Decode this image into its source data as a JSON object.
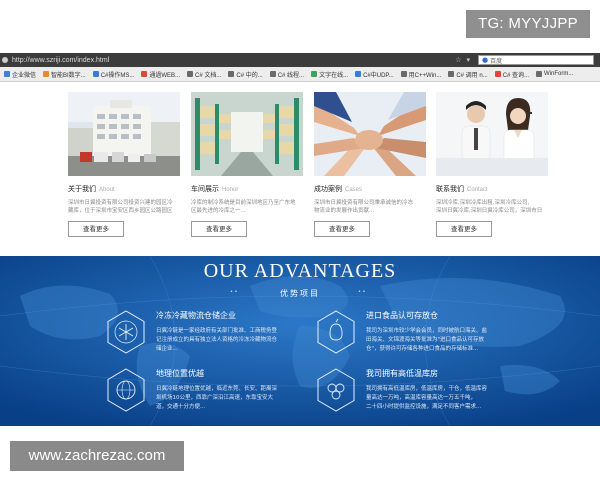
{
  "overlays": {
    "tg_label": "TG: MYYJJPP",
    "watermark": "www.zachrezac.com"
  },
  "browser": {
    "url": "http://www.szriji.com/index.html",
    "search_placeholder": "百度",
    "bookmarks": [
      {
        "label": "企业微信",
        "color": "#3b83d1"
      },
      {
        "label": "智能BI数字...",
        "color": "#e68a2e"
      },
      {
        "label": "C#操作MS...",
        "color": "#3a7bd5"
      },
      {
        "label": "通過WEB...",
        "color": "#d94a38"
      },
      {
        "label": "C# 文档...",
        "color": "#6a6a6a"
      },
      {
        "label": "C# 中的...",
        "color": "#6a6a6a"
      },
      {
        "label": "C# 线程...",
        "color": "#6a6a6a"
      },
      {
        "label": "文字在线...",
        "color": "#3ea35c"
      },
      {
        "label": "C#中UDP...",
        "color": "#3a7bd5"
      },
      {
        "label": "用C++Win...",
        "color": "#6a6a6a"
      },
      {
        "label": "C# 调用 n...",
        "color": "#6a6a6a"
      },
      {
        "label": "C# 查询...",
        "color": "#d94a38"
      },
      {
        "label": "WinForm...",
        "color": "#6a6a6a"
      }
    ]
  },
  "cards": [
    {
      "title": "关于我们",
      "title_en": "About",
      "desc1": "深圳市日冀投资有限公司投资兴建的园区冷",
      "desc2": "藏库，位于深圳市宝安区西乡园区公路园区",
      "button": "查看更多"
    },
    {
      "title": "车间展示",
      "title_en": "Honor",
      "desc1": "冷库的制冷系统是目前深圳地区乃至广东地",
      "desc2": "区最先进的冷库之一...",
      "button": "查看更多"
    },
    {
      "title": "成功案例",
      "title_en": "Cases",
      "desc1": "深圳市日冀投资有限公司秉承诚信的冷冻",
      "desc2": "物流业的发展作出贡献...",
      "button": "查看更多"
    },
    {
      "title": "联系我们",
      "title_en": "Contact",
      "desc1": "深圳冷库,深圳冷库出租,深圳冷库公司,",
      "desc2": "深圳日冀冷库,深圳日冀冷库公司，深圳市日",
      "button": "查看更多"
    }
  ],
  "advantages": {
    "title": "OUR ADVANTAGES",
    "subtitle": "优势项目",
    "items": [
      {
        "title": "冷冻冷藏物流仓储企业",
        "line1": "日冀冷链是一家经政府有关部门批准、工商税务登",
        "line2": "记注册成立的具有独立法人资格的冷冻冷藏物流仓",
        "line3": "储企业..."
      },
      {
        "title": "进口食品认可存放仓",
        "line1": "我司为深圳市较少学会会员，同时被航口海关、盐",
        "line2": "田海关、文锦渡海关等批准为\"进口食品认可存放",
        "line3": "仓\"，获得许可存储各种进口食品的存储标准..."
      },
      {
        "title": "地理位置优越",
        "line1": "日冀冷链地理位置优越，临近东莞、长安、距离深",
        "line2": "圳机场10公里，西靠广深沿江高速，东靠宝安大",
        "line3": "道，交通十分方便..."
      },
      {
        "title": "我司拥有高低温库房",
        "line1": "我司拥有高低温库房，低温库房，干仓，低温库容",
        "line2": "量高达一万吨，高温库容量高达一万五千吨，",
        "line3": "二十四小时提供监控设施，满足不同客户需求..."
      }
    ]
  }
}
